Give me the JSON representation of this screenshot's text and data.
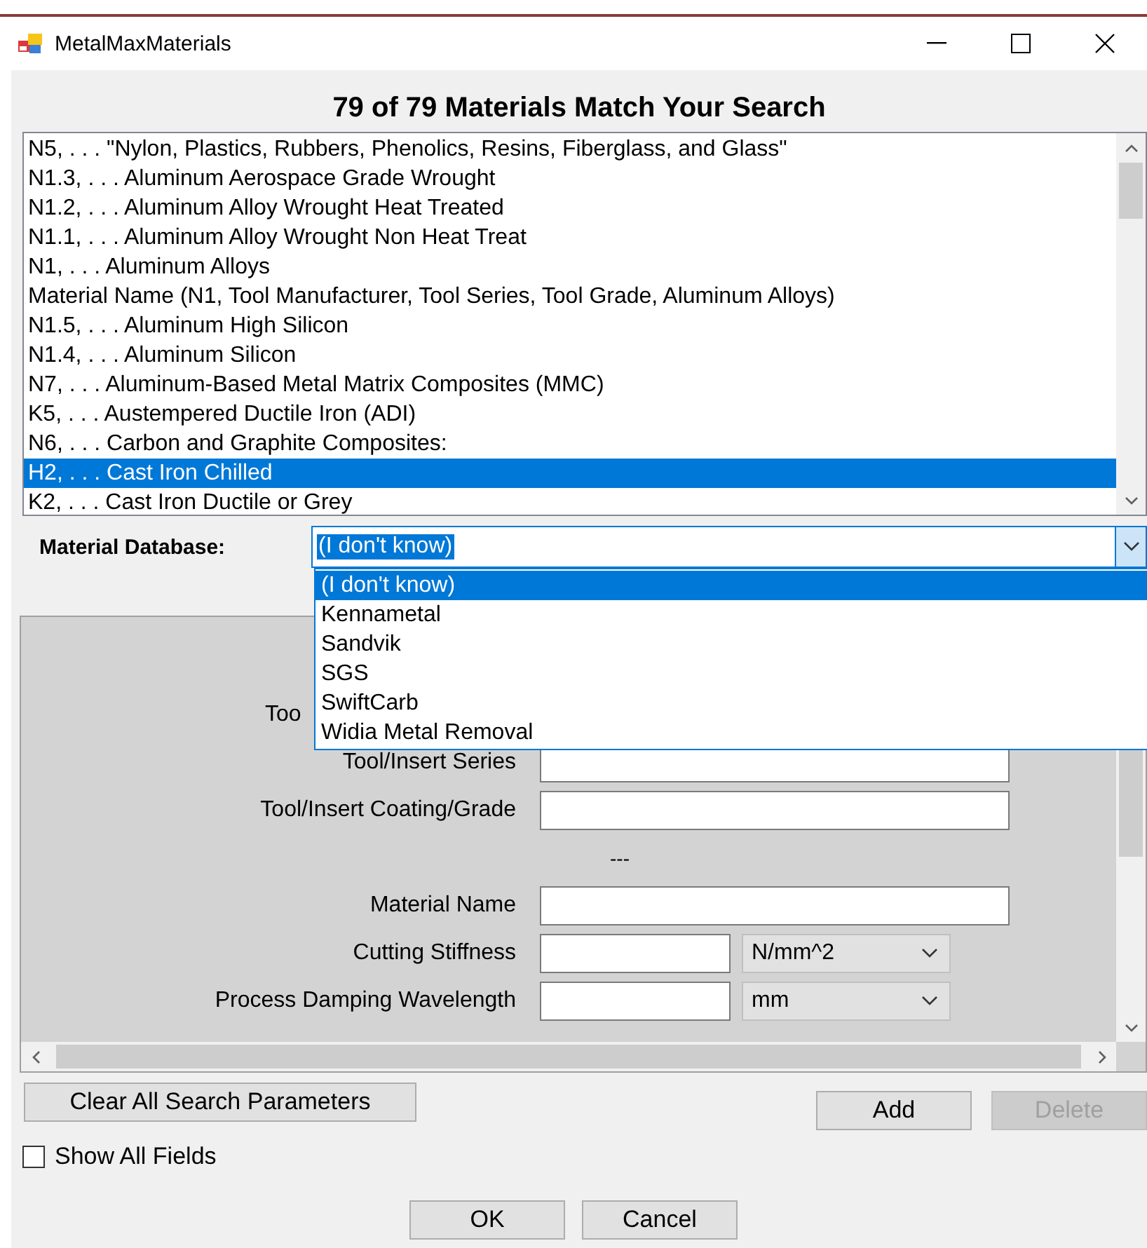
{
  "window": {
    "title": "MetalMaxMaterials"
  },
  "heading": "79 of 79 Materials Match Your Search",
  "materials": [
    {
      "label": "N5, . . . \"Nylon, Plastics, Rubbers, Phenolics, Resins, Fiberglass, and Glass\"",
      "selected": false
    },
    {
      "label": "N1.3, . . . Aluminum Aerospace Grade Wrought",
      "selected": false
    },
    {
      "label": "N1.2, . . . Aluminum Alloy Wrought Heat Treated",
      "selected": false
    },
    {
      "label": "N1.1, . . . Aluminum Alloy Wrought Non Heat Treat",
      "selected": false
    },
    {
      "label": "N1, . . . Aluminum Alloys",
      "selected": false
    },
    {
      "label": "Material Name (N1, Tool Manufacturer, Tool Series, Tool Grade, Aluminum Alloys)",
      "selected": false
    },
    {
      "label": "N1.5, . . . Aluminum High Silicon",
      "selected": false
    },
    {
      "label": "N1.4, . . . Aluminum Silicon",
      "selected": false
    },
    {
      "label": "N7, . . . Aluminum-Based Metal Matrix Composites (MMC)",
      "selected": false
    },
    {
      "label": "K5, . . . Austempered Ductile Iron (ADI)",
      "selected": false
    },
    {
      "label": "N6, . . . Carbon and Graphite Composites:",
      "selected": false
    },
    {
      "label": "H2, . . . Cast Iron Chilled",
      "selected": true
    },
    {
      "label": "K2, . . . Cast Iron Ductile or Grey",
      "selected": false
    }
  ],
  "material_database": {
    "label": "Material Database:",
    "value": "(I don't know)",
    "expanded": true,
    "options": [
      {
        "label": "(I don't know)",
        "selected": true
      },
      {
        "label": "Kennametal",
        "selected": false
      },
      {
        "label": "Sandvik",
        "selected": false
      },
      {
        "label": "SGS",
        "selected": false
      },
      {
        "label": "SwiftCarb",
        "selected": false
      },
      {
        "label": "Widia Metal Removal",
        "selected": false
      }
    ]
  },
  "search_fields": [
    {
      "kind": "covered",
      "label": "Too"
    },
    {
      "kind": "text",
      "label": "Tool/Insert Series"
    },
    {
      "kind": "text",
      "label": "Tool/Insert Coating/Grade"
    },
    {
      "kind": "separator",
      "label": "---"
    },
    {
      "kind": "text",
      "label": "Material Name"
    },
    {
      "kind": "unit",
      "label": "Cutting Stiffness",
      "unit": "N/mm^2"
    },
    {
      "kind": "unit",
      "label": "Process Damping Wavelength",
      "unit": "mm"
    }
  ],
  "clear_button": {
    "label": "Clear All Search Parameters"
  },
  "list_buttons": [
    {
      "label": "Add",
      "disabled": false
    },
    {
      "label": "Delete",
      "disabled": true
    }
  ],
  "show_all_fields": {
    "label": "Show All Fields",
    "checked": false
  },
  "dialog_buttons": [
    "OK",
    "Cancel"
  ]
}
